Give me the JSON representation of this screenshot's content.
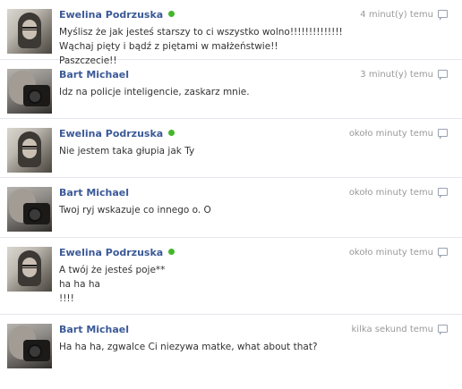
{
  "colors": {
    "name": "#3b5998",
    "online": "#42b72a",
    "timestamp": "#999999",
    "divider": "#e3e6ec"
  },
  "messages": [
    {
      "author": "Ewelina Podrzuska",
      "online": true,
      "avatar_icon": "profile-photo-woman-glasses",
      "time": "4 minut(y) temu",
      "lines": [
        "Myślisz że jak jesteś starszy to ci wszystko wolno!!!!!!!!!!!!!!",
        "Wąchaj pięty i bądź z piętami w małżeństwie!!",
        "Paszczecie!!"
      ]
    },
    {
      "author": "Bart Michael",
      "online": false,
      "avatar_icon": "profile-photo-man-camera",
      "time": "3 minut(y) temu",
      "lines": [
        "Idz na policje inteligencie, zaskarz mnie."
      ]
    },
    {
      "author": "Ewelina Podrzuska",
      "online": true,
      "avatar_icon": "profile-photo-woman-glasses",
      "time": "około minuty temu",
      "lines": [
        "Nie jestem taka głupia jak Ty"
      ]
    },
    {
      "author": "Bart Michael",
      "online": false,
      "avatar_icon": "profile-photo-man-camera",
      "time": "około minuty temu",
      "lines": [
        "Twoj ryj wskazuje co innego o. O"
      ]
    },
    {
      "author": "Ewelina Podrzuska",
      "online": true,
      "avatar_icon": "profile-photo-woman-glasses",
      "time": "około minuty temu",
      "lines": [
        "A twój że jesteś poje**",
        "ha ha ha",
        "!!!!"
      ]
    },
    {
      "author": "Bart Michael",
      "online": false,
      "avatar_icon": "profile-photo-man-camera",
      "time": "kilka sekund temu",
      "lines": [
        "Ha ha ha, zgwalce Ci niezywa matke, what about that?"
      ]
    }
  ]
}
